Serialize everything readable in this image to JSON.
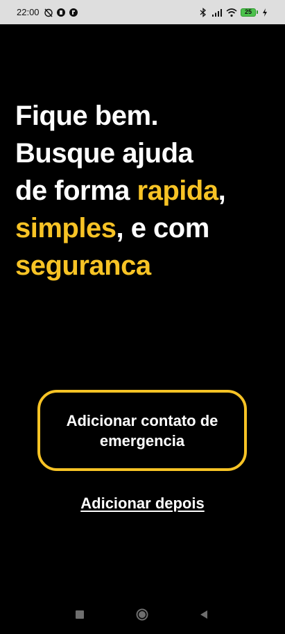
{
  "status_bar": {
    "time": "22:00",
    "battery_level": "25",
    "icons": [
      "alarm-off-icon",
      "app-notification-icon",
      "app-notification-icon",
      "bluetooth-icon",
      "signal-icon",
      "wifi-icon",
      "battery-icon",
      "charging-icon"
    ]
  },
  "headline": {
    "line1": "Fique bem.",
    "line2": "Busque ajuda",
    "line3_prefix": "de forma ",
    "line3_highlight": "rapida",
    "line3_suffix": ",",
    "line4_highlight": "simples",
    "line4_suffix": ", e com",
    "line5_highlight": "seguranca"
  },
  "primary_button": {
    "label": "Adicionar contato de emergencia"
  },
  "secondary_link": {
    "label": "Adicionar depois"
  },
  "colors": {
    "background": "#000000",
    "accent": "#f7c325",
    "text": "#ffffff",
    "status_bar": "#dedede"
  },
  "nav_bar": {
    "icons": [
      "recent-apps-icon",
      "home-icon",
      "back-icon"
    ]
  }
}
